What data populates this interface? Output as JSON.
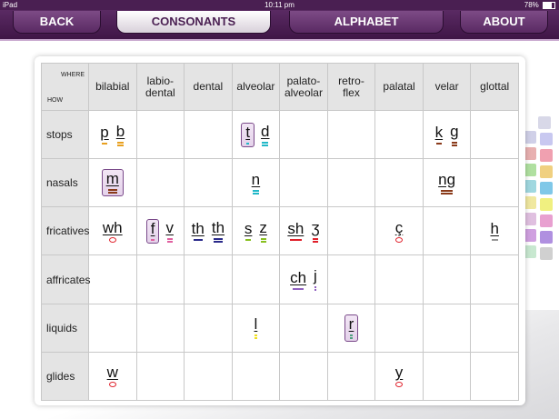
{
  "status": {
    "device": "iPad",
    "time": "10:11 pm",
    "battery": "78%"
  },
  "nav": {
    "back": "BACK",
    "consonants": "CONSONANTS",
    "alphabet": "ALPHABET",
    "about": "ABOUT"
  },
  "corner": {
    "where": "WHERE",
    "how": "HOW"
  },
  "columns": [
    {
      "l1": "bilabial",
      "l2": ""
    },
    {
      "l1": "labio-",
      "l2": "dental"
    },
    {
      "l1": "dental",
      "l2": ""
    },
    {
      "l1": "alveolar",
      "l2": ""
    },
    {
      "l1": "palato-",
      "l2": "alveolar"
    },
    {
      "l1": "retro-",
      "l2": "flex"
    },
    {
      "l1": "palatal",
      "l2": ""
    },
    {
      "l1": "velar",
      "l2": ""
    },
    {
      "l1": "glottal",
      "l2": ""
    }
  ],
  "rows": [
    "stops",
    "nasals",
    "fricatives",
    "affricates",
    "liquids",
    "glides"
  ],
  "cells": {
    "stops": {
      "bilabial": [
        {
          "s": "p",
          "c": "#e8a020"
        },
        {
          "s": "b",
          "c": "#e8a020",
          "dbl": true
        }
      ],
      "alveolar": [
        {
          "s": "t",
          "c": "#22b8c8",
          "box": true
        },
        {
          "s": "d",
          "c": "#22b8c8",
          "dbl": true
        }
      ],
      "velar": [
        {
          "s": "k",
          "c": "#8a3a1a"
        },
        {
          "s": "g",
          "c": "#8a3a1a",
          "dbl": true
        }
      ]
    },
    "nasals": {
      "bilabial": [
        {
          "s": "m",
          "c": "#8a3a1a",
          "box": true,
          "dbl": true
        }
      ],
      "alveolar": [
        {
          "s": "n",
          "c": "#22b8c8",
          "dbl": true
        }
      ],
      "velar": [
        {
          "s": "ng",
          "c": "#8a3a1a",
          "dbl": true
        }
      ]
    },
    "fricatives": {
      "bilabial": [
        {
          "s": "wh",
          "c": "#e0202a",
          "dot": true
        }
      ],
      "labio-dental": [
        {
          "s": "f",
          "c": "#e060a0",
          "box": true
        },
        {
          "s": "v",
          "c": "#e060a0",
          "dbl": true
        }
      ],
      "dental": [
        {
          "s": "th",
          "c": "#2a2a8a"
        },
        {
          "s": "th",
          "c": "#2a2a8a",
          "dbl": true
        }
      ],
      "alveolar": [
        {
          "s": "s",
          "c": "#88c020"
        },
        {
          "s": "z",
          "c": "#88c020",
          "dbl": true
        }
      ],
      "palato-alveolar": [
        {
          "s": "sh",
          "c": "#e0202a"
        },
        {
          "s": "ʒ",
          "c": "#e0202a",
          "dbl": true
        }
      ],
      "palatal": [
        {
          "s": "ç",
          "c": "#e0202a",
          "dot": true
        }
      ],
      "glottal": [
        {
          "s": "h",
          "c": "#999999"
        }
      ]
    },
    "affricates": {
      "palato-alveolar": [
        {
          "s": "ch",
          "c": "#9060c0"
        },
        {
          "s": "j",
          "c": "#9060c0",
          "dbl": true
        }
      ]
    },
    "liquids": {
      "alveolar": [
        {
          "s": "l",
          "c": "#f0e020",
          "dbl": true
        }
      ],
      "retroflex": [
        {
          "s": "r",
          "c": "#50a080",
          "box": true,
          "dbl": true
        }
      ]
    },
    "glides": {
      "bilabial": [
        {
          "s": "w",
          "c": "#e0202a",
          "dot": true
        }
      ],
      "palatal": [
        {
          "s": "y",
          "c": "#e0202a",
          "dot": true
        }
      ]
    }
  }
}
